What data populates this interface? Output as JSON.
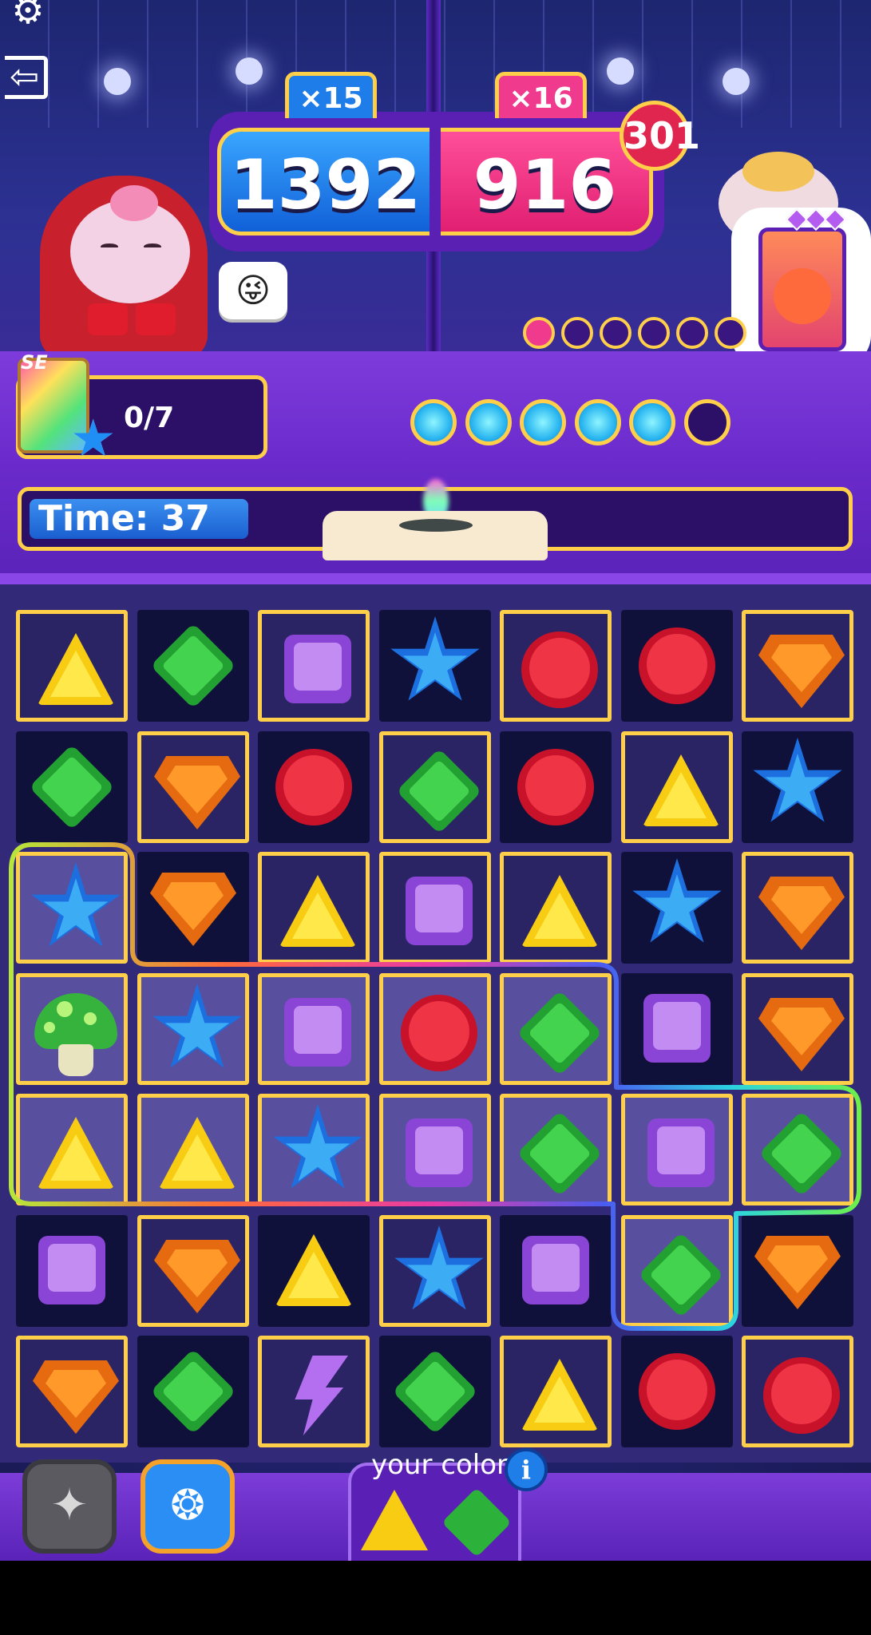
{
  "hud": {
    "settings_icon": "gear-icon",
    "exit_icon": "exit-door-icon"
  },
  "match": {
    "player": {
      "multiplier": "×15",
      "score": "1392",
      "color": "#1e7de8"
    },
    "opponent": {
      "multiplier": "×16",
      "score": "916",
      "color": "#ef3a8d",
      "badge": "301"
    },
    "opponent_pips": {
      "total": 6,
      "filled": 1
    },
    "emote_icon": "wink-face-icon"
  },
  "goal": {
    "card_label": "SE",
    "progress": "0/7",
    "star_icon": "star-icon"
  },
  "round_lights": {
    "total": 6,
    "lit": 5
  },
  "timer": {
    "label": "Time: 37",
    "fill_fraction": 0.27
  },
  "board": {
    "rows": [
      [
        "triangle",
        "diamond",
        "square",
        "star",
        "circle",
        "circle",
        "shield"
      ],
      [
        "diamond",
        "shield",
        "circle",
        "diamond",
        "circle",
        "triangle",
        "star"
      ],
      [
        "star",
        "shield",
        "triangle",
        "square",
        "triangle",
        "star",
        "shield"
      ],
      [
        "mushroom",
        "star",
        "square",
        "circle",
        "diamond",
        "square",
        "shield"
      ],
      [
        "triangle",
        "triangle",
        "star",
        "square",
        "diamond",
        "square",
        "diamond"
      ],
      [
        "square",
        "shield",
        "triangle",
        "star",
        "square",
        "diamond",
        "shield"
      ],
      [
        "shield",
        "diamond",
        "bolt",
        "diamond",
        "triangle",
        "circle",
        "circle"
      ]
    ],
    "dark_cells": [
      [
        0,
        1
      ],
      [
        0,
        3
      ],
      [
        0,
        5
      ],
      [
        1,
        0
      ],
      [
        1,
        2
      ],
      [
        1,
        4
      ],
      [
        1,
        6
      ],
      [
        2,
        1
      ],
      [
        2,
        5
      ],
      [
        3,
        5
      ],
      [
        5,
        0
      ],
      [
        5,
        2
      ],
      [
        5,
        4
      ],
      [
        5,
        6
      ],
      [
        6,
        1
      ],
      [
        6,
        3
      ],
      [
        6,
        5
      ]
    ],
    "selected_cells": [
      [
        2,
        0
      ],
      [
        3,
        0
      ],
      [
        3,
        1
      ],
      [
        3,
        2
      ],
      [
        3,
        3
      ],
      [
        3,
        4
      ],
      [
        4,
        0
      ],
      [
        4,
        1
      ],
      [
        4,
        2
      ],
      [
        4,
        3
      ],
      [
        4,
        4
      ],
      [
        4,
        5
      ],
      [
        4,
        6
      ],
      [
        5,
        5
      ]
    ],
    "colors": {
      "triangle": "#f7cc12",
      "diamond": "#2cb23a",
      "square": "#a35ee6",
      "star": "#2a8ef0",
      "circle": "#e2263a",
      "shield": "#f5841c",
      "mushroom": "#36b33c",
      "bolt": "#b46ff0"
    }
  },
  "footer": {
    "booster_1_icon": "sparkle-stars-icon",
    "booster_2_icon": "scarab-beetle-icon",
    "colors_label": "your colors",
    "info_icon": "info-icon",
    "your_colors": [
      "triangle",
      "diamond"
    ]
  }
}
